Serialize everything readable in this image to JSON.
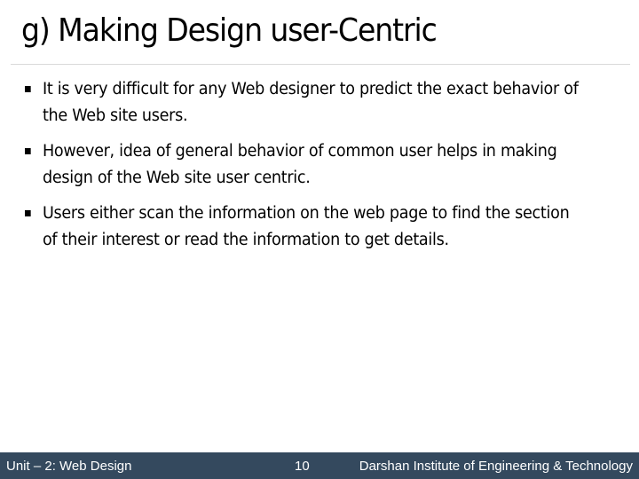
{
  "slide": {
    "title": "g) Making Design user-Centric",
    "bullets": [
      {
        "text": "It is very difficult for any Web designer to predict the exact behavior of the Web site users."
      },
      {
        "text": "However, idea of general behavior of common user helps in making design of the Web site user centric."
      },
      {
        "text": "Users either scan the information on the web page to find the section of their interest or read the information to get details."
      }
    ]
  },
  "footer": {
    "unit": "Unit – 2: Web Design",
    "page_number": "10",
    "institute": "Darshan Institute of Engineering & Technology",
    "background_color": "#34495e"
  }
}
